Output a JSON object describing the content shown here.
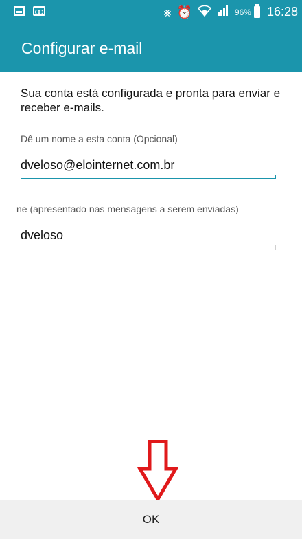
{
  "status_bar": {
    "battery": "96%",
    "time": "16:28",
    "icons": [
      "gallery-icon",
      "voicemail-icon",
      "mute-icon",
      "alarm-icon",
      "wifi-icon",
      "signal-icon",
      "battery-icon"
    ]
  },
  "app_bar": {
    "title": "Configurar e-mail"
  },
  "main": {
    "message": "Sua conta está configurada e pronta para enviar e receber e-mails.",
    "account_name": {
      "label": "Dê um nome a esta conta (Opcional)",
      "value": "dveloso@elointernet.com.br"
    },
    "sender_name": {
      "label": "ne (apresentado nas mensagens a serem enviadas)",
      "value": "dveloso"
    }
  },
  "footer": {
    "ok_label": "OK"
  },
  "colors": {
    "accent": "#1b95ac",
    "arrow": "#e0191b"
  }
}
